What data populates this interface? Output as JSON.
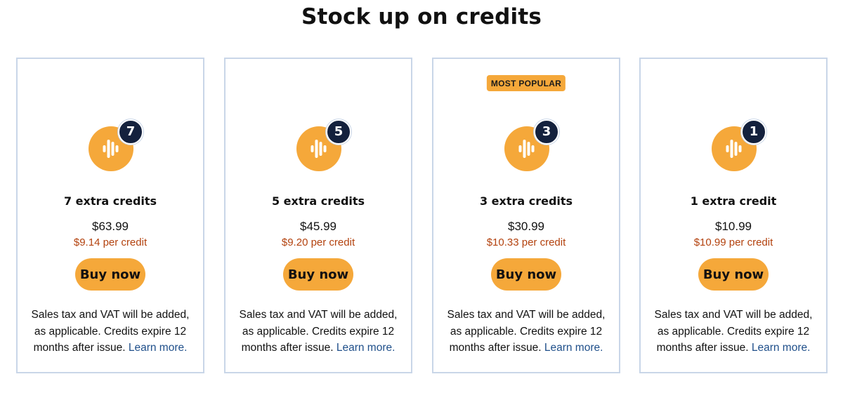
{
  "page": {
    "title": "Stock up on credits"
  },
  "colors": {
    "accent": "#f5a83a",
    "badge_dark": "#14213d",
    "per_credit_text": "#b3420e",
    "link": "#1f4f8a",
    "card_border": "#c9d6e8"
  },
  "plans": [
    {
      "count": "7",
      "title": "7 extra credits",
      "price": "$63.99",
      "per_credit": "$9.14 per credit",
      "buy_label": "Buy now",
      "note_text": "Sales tax and VAT will be added, as applicable. Credits expire 12 months after issue.",
      "learn_more": "Learn more.",
      "icon": "soundwave-icon"
    },
    {
      "count": "5",
      "title": "5 extra credits",
      "price": "$45.99",
      "per_credit": "$9.20 per credit",
      "buy_label": "Buy now",
      "note_text": "Sales tax and VAT will be added, as applicable. Credits expire 12 months after issue.",
      "learn_more": "Learn more.",
      "icon": "soundwave-icon"
    },
    {
      "badge": "MOST POPULAR",
      "count": "3",
      "title": "3 extra credits",
      "price": "$30.99",
      "per_credit": "$10.33 per credit",
      "buy_label": "Buy now",
      "note_text": "Sales tax and VAT will be added, as applicable. Credits expire 12 months after issue.",
      "learn_more": "Learn more.",
      "icon": "soundwave-icon"
    },
    {
      "count": "1",
      "title": "1 extra credit",
      "price": "$10.99",
      "per_credit": "$10.99 per credit",
      "buy_label": "Buy now",
      "note_text": "Sales tax and VAT will be added, as applicable. Credits expire 12 months after issue.",
      "learn_more": "Learn more.",
      "icon": "soundwave-icon"
    }
  ]
}
